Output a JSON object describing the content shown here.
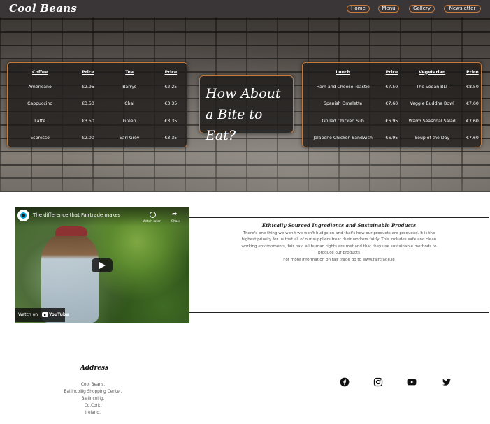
{
  "nav": {
    "brand": "Cool Beans",
    "links": [
      "Home",
      "Menu",
      "Gallery",
      "Newsletter"
    ]
  },
  "hero": {
    "drinks_table": {
      "headers": [
        "Coffee",
        "Price",
        "Tea",
        "Price"
      ],
      "rows": [
        [
          "Americano",
          "€2.95",
          "Barrys",
          "€2.25"
        ],
        [
          "Cappuccino",
          "€3.50",
          "Chai",
          "€3.35"
        ],
        [
          "Latte",
          "€3.50",
          "Green",
          "€3.35"
        ],
        [
          "Espresso",
          "€2.00",
          "Earl Grey",
          "€3.35"
        ]
      ]
    },
    "bite_heading": "How About a Bite to Eat?",
    "food_table": {
      "headers": [
        "Lunch",
        "Price",
        "Vegetarian",
        "Price"
      ],
      "rows": [
        [
          "Ham and Cheese Toastie",
          "€7.50",
          "The Vegan BLT",
          "€8.50"
        ],
        [
          "Spanish Omelette",
          "€7.60",
          "Veggie Buddha Bowl",
          "€7.60"
        ],
        [
          "Grilled Chicken Sub",
          "€6.95",
          "Warm Seasonal Salad",
          "€7.60"
        ],
        [
          "Jalapeño Chicken Sandwich",
          "€6.95",
          "Soup of the Day",
          "€7.60"
        ]
      ]
    }
  },
  "video": {
    "title": "The difference that Fairtrade makes",
    "watch_later": "Watch later",
    "share": "Share",
    "watch_on": "Watch on",
    "youtube": "YouTube"
  },
  "info": {
    "title": "Ethically Sourced Ingredients and Sustainable Products",
    "body": "There's one thing we won't we won't budge on and that's how our products are produced. It is the highest priority for us that all of our suppliers treat their workers fairly. This includes safe and clean working environments, fair pay, all human rights are met and that they use sustainable methods to produce our products",
    "more": "For more information on fair trade go to www.fairtrade.ie"
  },
  "footer": {
    "address_title": "Address",
    "address_lines": [
      "Cool Beans.",
      "Ballincollig Shopping Center.",
      "Ballincollig.",
      "Co.Cork.",
      "Ireland."
    ],
    "social_icons": [
      "facebook-icon",
      "instagram-icon",
      "youtube-icon",
      "twitter-icon"
    ]
  },
  "colors": {
    "nav_bg": "#3a3638",
    "accent": "#c87a3a",
    "panel_bg": "#1e1c1b"
  }
}
